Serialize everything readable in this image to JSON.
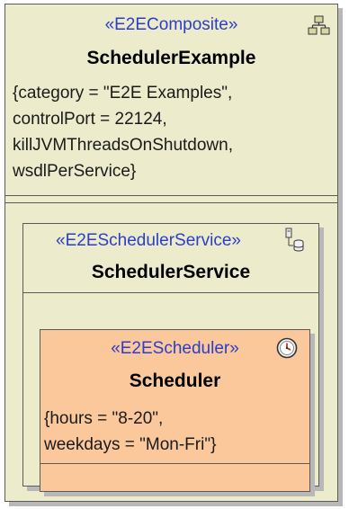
{
  "composite": {
    "stereotype": "«E2EComposite»",
    "name": "SchedulerExample",
    "tags": [
      "{category = \"E2E Examples\",",
      "controlPort = 22124,",
      "killJVMThreadsOnShutdown,",
      "wsdlPerService}"
    ],
    "icon": "composite-icon"
  },
  "service": {
    "stereotype": "«E2ESchedulerService»",
    "name": "SchedulerService",
    "icon": "service-icon"
  },
  "scheduler": {
    "stereotype": "«E2EScheduler»",
    "name": "Scheduler",
    "tags": [
      "{hours = \"8-20\",",
      "weekdays = \"Mon-Fri\"}"
    ],
    "icon": "clock-icon"
  },
  "colors": {
    "composite_fill": "#ecebcc",
    "scheduler_fill": "#fbc89c",
    "stereotype_text": "#2b3ec9",
    "border": "#5a5a5a"
  }
}
